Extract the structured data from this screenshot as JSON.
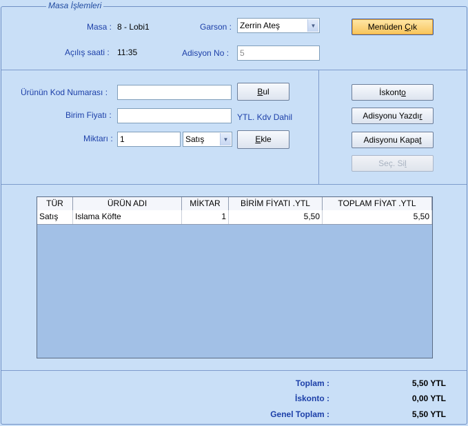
{
  "group_title": "Masa İşlemleri",
  "masa": {
    "label": "Masa :",
    "value": "8 - Lobi1"
  },
  "acilis": {
    "label": "Açılış saati :",
    "value": "11:35"
  },
  "garson": {
    "label": "Garson :",
    "value": "Zerrin Ateş"
  },
  "adisyon_no": {
    "label": "Adisyon No :",
    "value": "5"
  },
  "menu_button": {
    "pre": "Menüden ",
    "accel": "Ç",
    "post": "ık"
  },
  "product": {
    "code_label": "Ürünün Kod Numarası :",
    "code_value": "",
    "price_label": "Birim Fiyatı :",
    "price_value": "",
    "price_unit": "YTL.  Kdv Dahil",
    "qty_label": "Miktarı :",
    "qty_value": "1",
    "type_value": "Satış"
  },
  "buttons": {
    "bul": {
      "accel": "B",
      "post": "ul"
    },
    "ekle": {
      "accel": "E",
      "post": "kle"
    },
    "iskonto": {
      "pre": "İskont",
      "accel": "o",
      "post": ""
    },
    "yazdir": {
      "pre": "Adisyonu Yazdı",
      "accel": "r",
      "post": ""
    },
    "kapat": {
      "pre": "Adisyonu Kapa",
      "accel": "t",
      "post": ""
    },
    "sec_sil": {
      "pre": "Seç. Si",
      "accel": "l",
      "post": ""
    }
  },
  "table": {
    "headers": [
      "TÜR",
      "ÜRÜN ADI",
      "MİKTAR",
      "BİRİM FİYATI .YTL",
      "TOPLAM FİYAT .YTL"
    ],
    "rows": [
      {
        "tur": "Satış",
        "urun": "Islama Köfte",
        "miktar": "1",
        "birim": "5,50",
        "toplam": "5,50"
      }
    ]
  },
  "totals": {
    "toplam_label": "Toplam :",
    "toplam_value": "5,50 YTL",
    "iskonto_label": "İskonto :",
    "iskonto_value": "0,00 YTL",
    "genel_label": "Genel Toplam :",
    "genel_value": "5,50 YTL"
  },
  "colors": {
    "background": "#c9dff7",
    "label": "#1c3fa8",
    "grid_empty": "#a2c0e6",
    "hot_button": "#f7c45a"
  }
}
